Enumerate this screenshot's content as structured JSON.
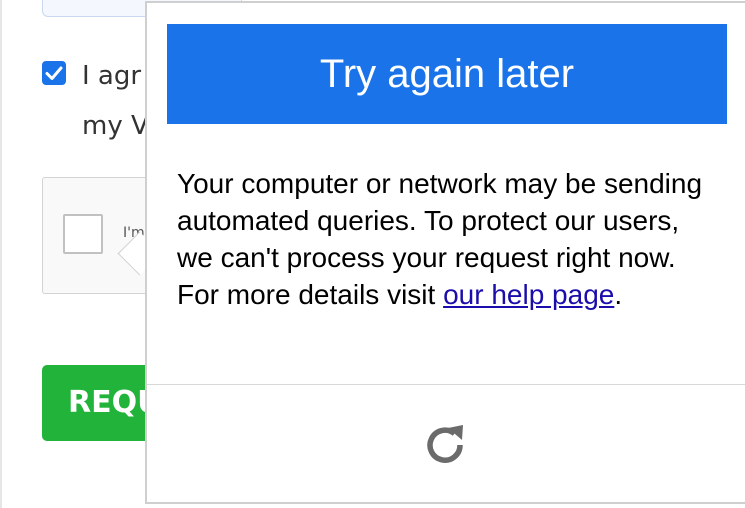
{
  "form": {
    "agree_line_1": "I agr",
    "agree_line_2": "my V",
    "agree_checked": true,
    "captcha_label": "I'm",
    "request_button_label": "REQU"
  },
  "popup": {
    "title": "Try again later",
    "message_before_link": "Your computer or network may be sending automated queries. To protect our users, we can't process your request right now. For more details visit ",
    "link_text": "our help page",
    "message_after_link": ".",
    "reload_icon": "reload-icon"
  },
  "colors": {
    "header_blue": "#1a73e8",
    "link_blue": "#1a0dab",
    "button_green": "#22b33a"
  }
}
